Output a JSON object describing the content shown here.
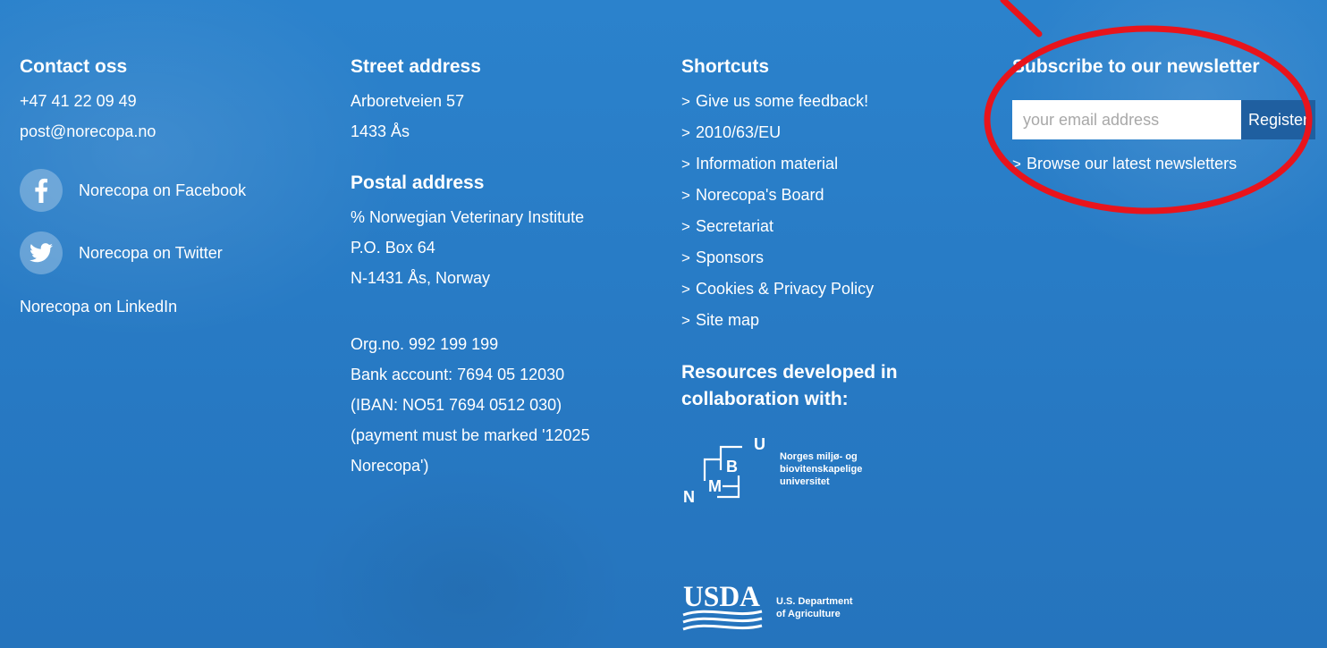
{
  "contact": {
    "heading": "Contact oss",
    "phone": "+47 41 22 09 49",
    "email": "post@norecopa.no",
    "facebook_label": "Norecopa on Facebook",
    "twitter_label": "Norecopa on Twitter",
    "linkedin_label": "Norecopa on LinkedIn"
  },
  "street_address": {
    "heading": "Street address",
    "lines": [
      "Arboretveien 57",
      "1433 Ås"
    ]
  },
  "postal_address": {
    "heading": "Postal address",
    "lines": [
      "% Norwegian Veterinary Institute",
      "P.O. Box 64",
      "N-1431 Ås, Norway"
    ]
  },
  "org_info": {
    "lines": [
      "Org.no. 992 199 199",
      "Bank account: 7694 05 12030",
      "(IBAN: NO51 7694 0512 030)",
      "(payment must be marked '12025",
      "Norecopa')"
    ]
  },
  "shortcuts": {
    "heading": "Shortcuts",
    "chevron": ">",
    "items": [
      "Give us some feedback!",
      "2010/63/EU",
      "Information material",
      "Norecopa's Board",
      "Secretariat",
      "Sponsors",
      "Cookies & Privacy Policy",
      "Site map"
    ]
  },
  "resources": {
    "heading_line1": "Resources developed in",
    "heading_line2": "collaboration with:",
    "nmbu": {
      "letters": [
        "N",
        "M",
        "B",
        "U"
      ],
      "text_lines": [
        "Norges miljø- og",
        "biovitenskapelige",
        "universitet"
      ]
    },
    "usda": {
      "mark": "USDA",
      "text_lines": [
        "U.S. Department",
        "of Agriculture"
      ]
    }
  },
  "newsletter": {
    "heading": "Subscribe to our newsletter",
    "email_placeholder": "your email address",
    "register_label": "Register",
    "browse_label": "Browse our latest newsletters"
  },
  "colors": {
    "background": "#2a7fc9",
    "button": "#1f5fa0",
    "annotation": "#e8141c"
  },
  "icons": [
    "facebook-icon",
    "twitter-icon",
    "chevron-right-icon",
    "nmbu-logo",
    "usda-logo"
  ]
}
